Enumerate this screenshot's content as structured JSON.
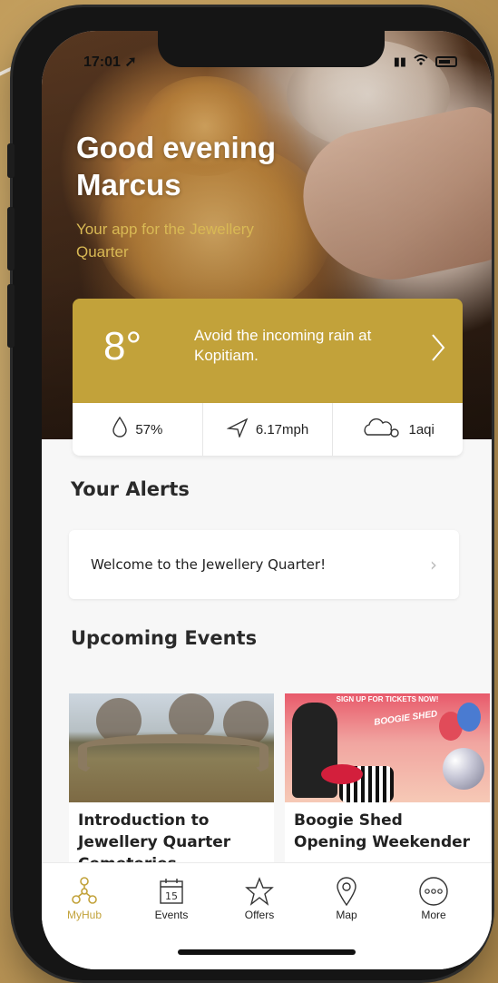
{
  "status_bar": {
    "time": "17:01"
  },
  "hero": {
    "greeting_line1": "Good evening",
    "greeting_line2": "Marcus",
    "tagline": "Your app for the Jewellery Quarter"
  },
  "weather": {
    "temperature": "8°",
    "message": "Avoid the incoming rain at Kopitiam.",
    "humidity": "57%",
    "wind": "6.17mph",
    "air_quality": "1aqi"
  },
  "alerts": {
    "heading": "Your Alerts",
    "items": [
      {
        "text": "Welcome to the Jewellery Quarter!"
      }
    ]
  },
  "events": {
    "heading": "Upcoming Events",
    "items": [
      {
        "title": "Introduction to Jewellery Quarter Cemeteries"
      },
      {
        "title": "Boogie Shed Opening Weekender",
        "banner": "SIGN UP FOR TICKETS NOW!",
        "logo": "BOOGIE SHED"
      }
    ]
  },
  "tabbar": {
    "items": [
      {
        "label": "MyHub",
        "icon": "myhub-icon",
        "active": true
      },
      {
        "label": "Events",
        "icon": "calendar-icon",
        "day": "15"
      },
      {
        "label": "Offers",
        "icon": "star-icon"
      },
      {
        "label": "Map",
        "icon": "map-pin-icon"
      },
      {
        "label": "More",
        "icon": "more-icon"
      }
    ]
  },
  "colors": {
    "accent": "#c2a23a",
    "background": "#f7f7f7"
  }
}
